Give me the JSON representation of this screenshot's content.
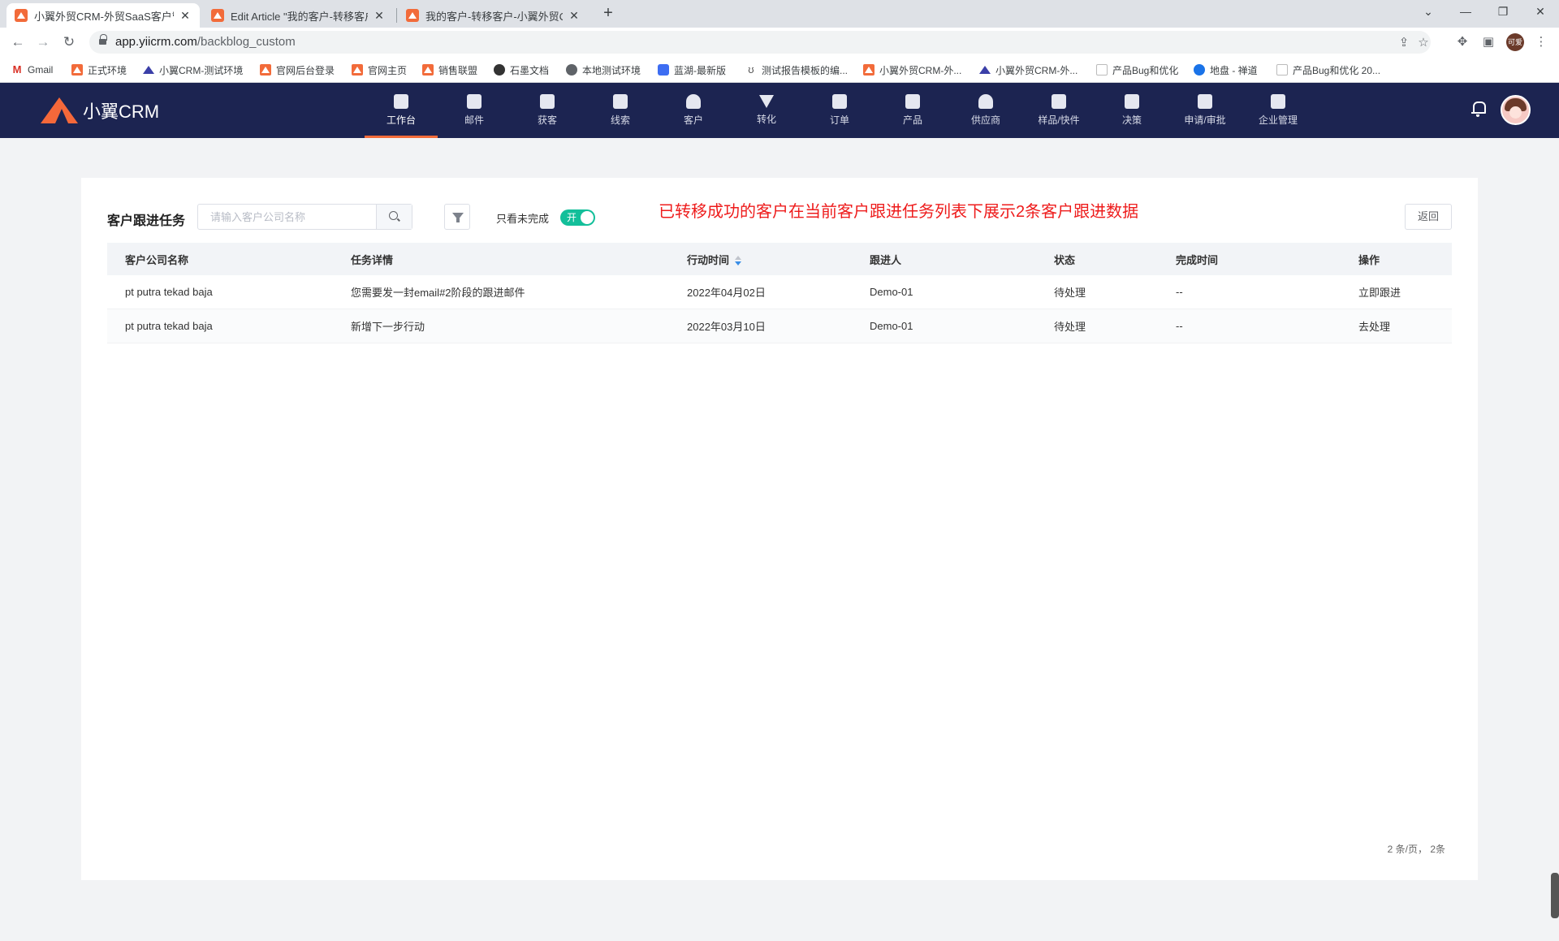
{
  "browser": {
    "tabs": [
      {
        "title": "小翼外贸CRM-外贸SaaS客户管理",
        "active": true
      },
      {
        "title": "Edit Article \"我的客户-转移客户",
        "active": false
      },
      {
        "title": "我的客户-转移客户-小翼外贸CRM",
        "active": false
      }
    ],
    "url_host": "app.yiicrm.com",
    "url_path": "/backblog_custom",
    "profile_label": "可爱",
    "bookmarks": [
      {
        "label": "Gmail",
        "icon": "gmail"
      },
      {
        "label": "正式环境",
        "icon": "crm"
      },
      {
        "label": "小翼CRM-测试环境",
        "icon": "triangle"
      },
      {
        "label": "官网后台登录",
        "icon": "crm"
      },
      {
        "label": "官网主页",
        "icon": "crm"
      },
      {
        "label": "销售联盟",
        "icon": "crm"
      },
      {
        "label": "石墨文档",
        "icon": "circle"
      },
      {
        "label": "本地测试环境",
        "icon": "globe"
      },
      {
        "label": "蓝湖-最新版",
        "icon": "lanhu"
      },
      {
        "label": "测试报告模板的编...",
        "icon": "scroll"
      },
      {
        "label": "小翼外贸CRM-外...",
        "icon": "crm"
      },
      {
        "label": "小翼外贸CRM-外...",
        "icon": "triangle"
      },
      {
        "label": "产品Bug和优化",
        "icon": "page"
      },
      {
        "label": "地盘 - 禅道",
        "icon": "zentao"
      },
      {
        "label": "产品Bug和优化 20...",
        "icon": "page"
      }
    ]
  },
  "app": {
    "logo_text": "小翼CRM",
    "nav": [
      {
        "label": "工作台",
        "icon": "workbench-icon",
        "active": true
      },
      {
        "label": "邮件",
        "icon": "mail-icon"
      },
      {
        "label": "获客",
        "icon": "acquire-icon"
      },
      {
        "label": "线索",
        "icon": "lead-icon"
      },
      {
        "label": "客户",
        "icon": "customer-icon"
      },
      {
        "label": "转化",
        "icon": "funnel-icon"
      },
      {
        "label": "订单",
        "icon": "order-icon"
      },
      {
        "label": "产品",
        "icon": "product-icon"
      },
      {
        "label": "供应商",
        "icon": "supplier-icon"
      },
      {
        "label": "样品/快件",
        "icon": "sample-icon"
      },
      {
        "label": "决策",
        "icon": "decision-icon"
      },
      {
        "label": "申请/审批",
        "icon": "approval-icon"
      },
      {
        "label": "企业管理",
        "icon": "enterprise-icon"
      }
    ],
    "accent_color": "#f26b3a",
    "header_bg": "#1c2451"
  },
  "page": {
    "title": "客户跟进任务",
    "search_placeholder": "请输入客户公司名称",
    "only_incomplete_label": "只看未完成",
    "toggle_text": "开",
    "toggle_on": true,
    "annotation": "已转移成功的客户在当前客户跟进任务列表下展示2条客户跟进数据",
    "back_label": "返回",
    "columns": [
      "客户公司名称",
      "任务详情",
      "行动时间",
      "跟进人",
      "状态",
      "完成时间",
      "操作"
    ],
    "rows": [
      {
        "company": "pt putra tekad baja",
        "detail": "您需要发一封email#2阶段的跟进邮件",
        "time": "2022年04月02日",
        "owner": "Demo-01",
        "status": "待处理",
        "done": "--",
        "action": "立即跟进"
      },
      {
        "company": "pt putra tekad baja",
        "detail": "新增下一步行动",
        "time": "2022年03月10日",
        "owner": "Demo-01",
        "status": "待处理",
        "done": "--",
        "action": "去处理"
      }
    ],
    "pagination": "2 条/页， 2条"
  }
}
